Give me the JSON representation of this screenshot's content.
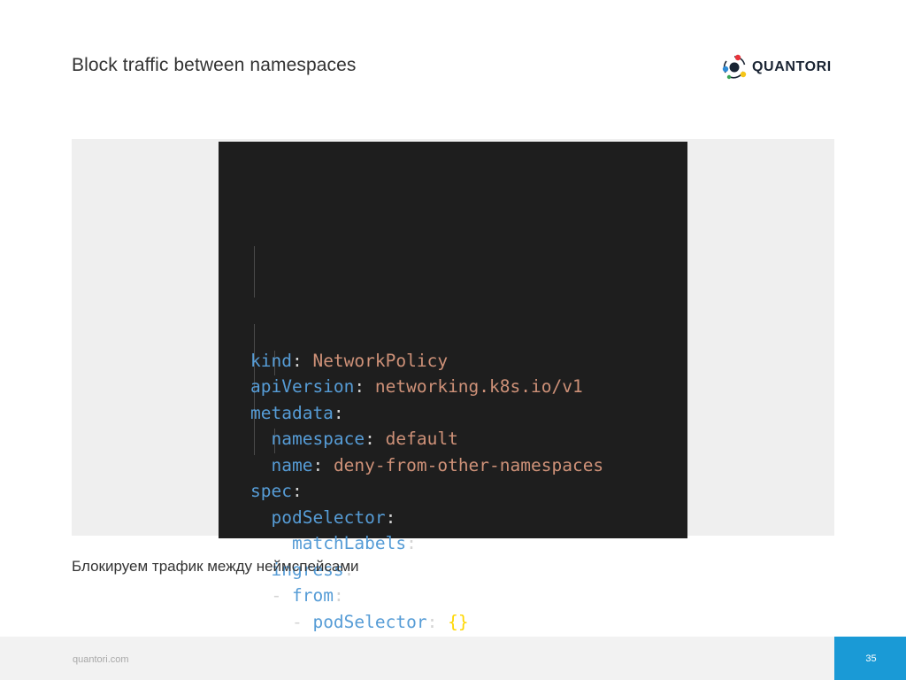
{
  "slide": {
    "title": "Block traffic between namespaces",
    "caption": "Блокируем трафик между неймспейсами"
  },
  "logo": {
    "text": "QUANTORI",
    "colors": [
      "#e8343b",
      "#f5c518",
      "#2e8bd6",
      "#3aa655",
      "#1a2433"
    ]
  },
  "code": {
    "lines": [
      {
        "indent": "",
        "key": "kind",
        "sep": ": ",
        "value": "NetworkPolicy"
      },
      {
        "indent": "",
        "key": "apiVersion",
        "sep": ": ",
        "value": "networking.k8s.io/v1"
      },
      {
        "indent": "",
        "key": "metadata",
        "sep": ":",
        "value": ""
      },
      {
        "indent": "  ",
        "key": "namespace",
        "sep": ": ",
        "value": "default"
      },
      {
        "indent": "  ",
        "key": "name",
        "sep": ": ",
        "value": "deny-from-other-namespaces"
      },
      {
        "indent": "",
        "key": "spec",
        "sep": ":",
        "value": ""
      },
      {
        "indent": "  ",
        "key": "podSelector",
        "sep": ":",
        "value": ""
      },
      {
        "indent": "    ",
        "key": "matchLabels",
        "sep": ":",
        "value": ""
      },
      {
        "indent": "  ",
        "key": "ingress",
        "sep": ":",
        "value": ""
      },
      {
        "indent": "  - ",
        "key": "from",
        "sep": ":",
        "value": ""
      },
      {
        "indent": "    - ",
        "key": "podSelector",
        "sep": ": ",
        "value": "{}"
      }
    ],
    "colors": {
      "key": "#569cd6",
      "value": "#ce9178",
      "punct": "#d4d4d4",
      "brace": "#ffd700",
      "background": "#1e1e1e"
    }
  },
  "footer": {
    "url": "quantori.com",
    "page_number": "35",
    "accent": "#1a9ad6"
  }
}
